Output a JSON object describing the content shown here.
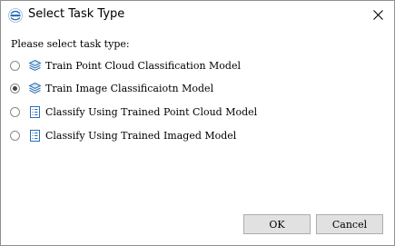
{
  "dialog": {
    "title": "Select Task Type",
    "prompt": "Please select task type:",
    "selected_option": 1,
    "options": [
      {
        "label": "Train Point Cloud Classification Model",
        "icon": "layers-icon"
      },
      {
        "label": "Train Image Classificaiotn Model",
        "icon": "layers-icon"
      },
      {
        "label": "Classify Using Trained Point Cloud Model",
        "icon": "list-document-icon"
      },
      {
        "label": "Classify Using Trained Imaged Model",
        "icon": "list-document-icon"
      }
    ],
    "ok_label": "OK",
    "cancel_label": "Cancel"
  },
  "colors": {
    "window_border": "#8f8f8f",
    "button_face": "#e1e1e1",
    "icon_blue": "#2a6fb7"
  }
}
